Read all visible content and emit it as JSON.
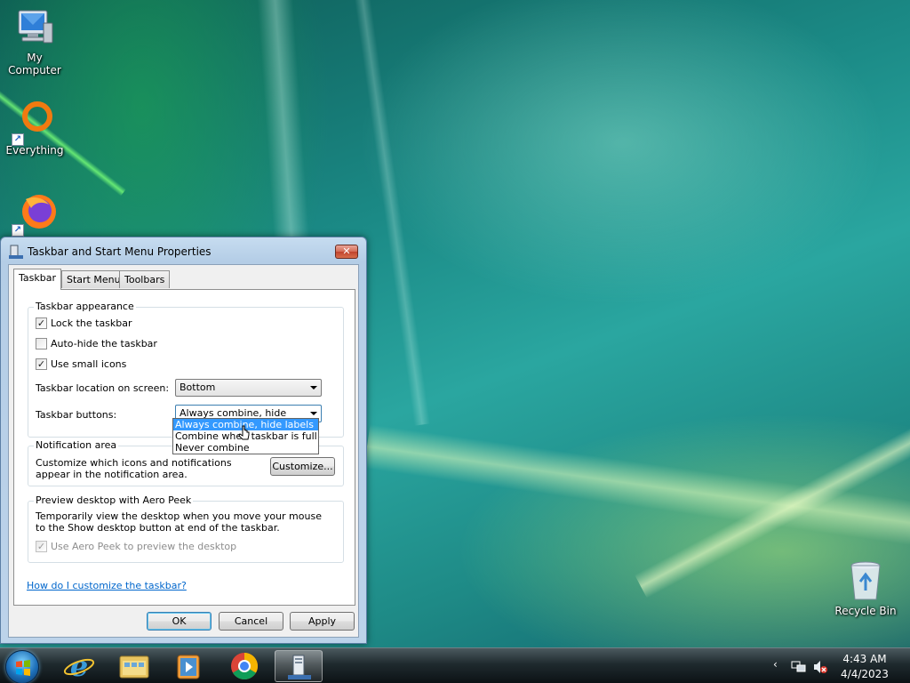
{
  "desktop": {
    "icons": [
      {
        "label": "My Computer"
      },
      {
        "label": "Everything"
      },
      {
        "label": ""
      },
      {
        "label": "Recycle Bin"
      }
    ]
  },
  "dialog": {
    "title": "Taskbar and Start Menu Properties",
    "close_label": "✕",
    "tabs": [
      {
        "label": "Taskbar",
        "active": true
      },
      {
        "label": "Start Menu",
        "active": false
      },
      {
        "label": "Toolbars",
        "active": false
      }
    ],
    "appearance": {
      "group_title": "Taskbar appearance",
      "lock_label": "Lock the taskbar",
      "lock_checked": true,
      "autohide_label": "Auto-hide the taskbar",
      "autohide_checked": false,
      "small_icons_label": "Use small icons",
      "small_icons_checked": true,
      "location_label": "Taskbar location on screen:",
      "location_value": "Bottom",
      "buttons_label": "Taskbar buttons:",
      "buttons_value": "Always combine, hide labels",
      "buttons_options": [
        {
          "label": "Always combine, hide labels",
          "selected": true
        },
        {
          "label": "Combine when taskbar is full",
          "selected": false
        },
        {
          "label": "Never combine",
          "selected": false
        }
      ]
    },
    "notification": {
      "group_title": "Notification area",
      "description": "Customize which icons and notifications appear in the notification area.",
      "customize_label": "Customize..."
    },
    "aero_peek": {
      "group_title": "Preview desktop with Aero Peek",
      "description": "Temporarily view the desktop when you move your mouse to the Show desktop button at end of the taskbar.",
      "checkbox_label": "Use Aero Peek to preview the desktop",
      "checked": true,
      "disabled": true
    },
    "help_link": "How do I customize the taskbar?",
    "ok_label": "OK",
    "cancel_label": "Cancel",
    "apply_label": "Apply"
  },
  "taskbar": {
    "pinned": [
      "internet-explorer",
      "windows-explorer",
      "media-player",
      "chrome",
      "taskbar-properties"
    ],
    "tray": {
      "time": "4:43 AM",
      "date": "4/4/2023",
      "chevron": "‹"
    }
  },
  "colors": {
    "selection": "#3399ff",
    "link": "#0066cc"
  }
}
